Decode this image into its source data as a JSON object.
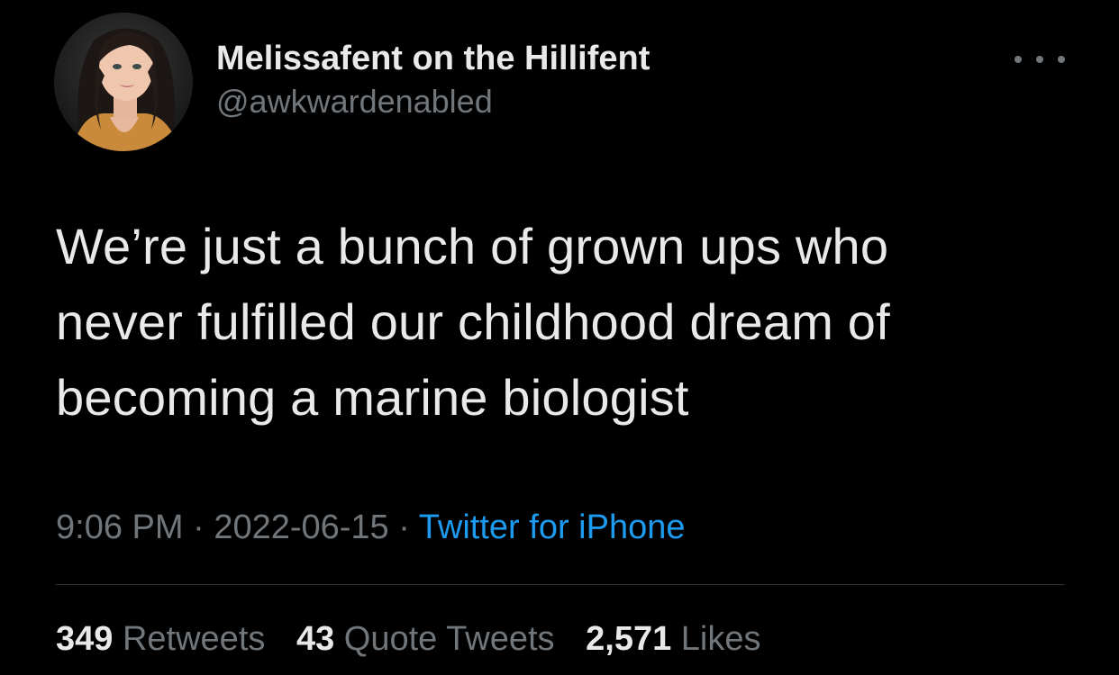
{
  "author": {
    "display_name": "Melissafent on the Hillifent",
    "handle": "@awkwardenabled",
    "avatar_icon": "profile-photo"
  },
  "menu": {
    "icon": "more-dots-icon"
  },
  "tweet": {
    "text": "We’re just a bunch of grown ups who\nnever fulfilled our childhood dream of\nbecoming a marine biologist",
    "time": "9:06 PM",
    "separator": " · ",
    "date": "2022-06-15",
    "source": "Twitter for iPhone"
  },
  "stats": {
    "retweets_count": "349",
    "retweets_label": "Retweets",
    "quotes_count": "43",
    "quotes_label": "Quote Tweets",
    "likes_count": "2,571",
    "likes_label": "Likes"
  },
  "colors": {
    "background": "#000000",
    "text": "#e7e9ea",
    "muted": "#71767b",
    "link": "#1d9bf0",
    "divider": "#2f3336"
  }
}
